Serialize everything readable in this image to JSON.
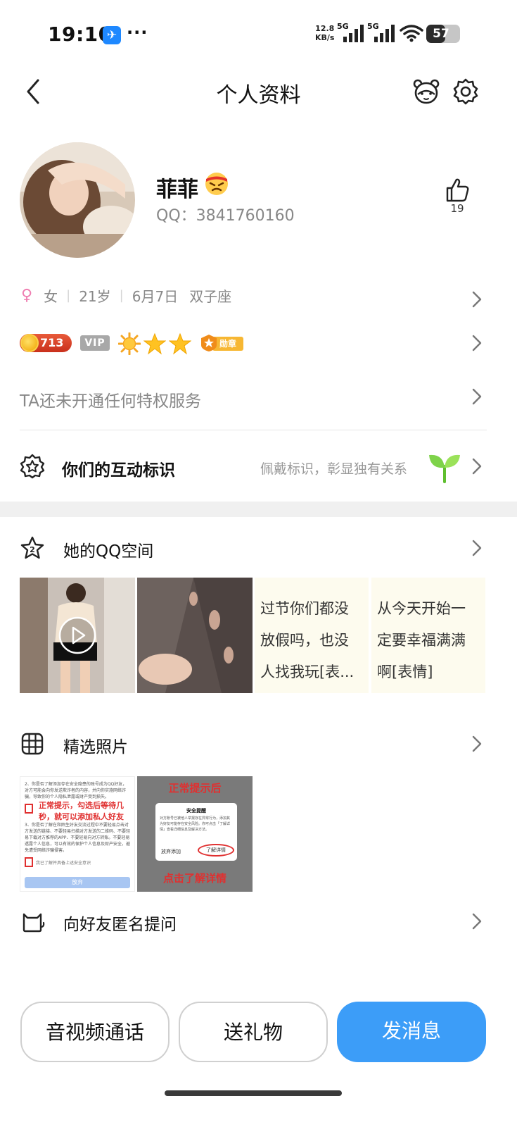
{
  "status_bar": {
    "time": "19:10",
    "app_icon_glyph": "✈",
    "more": "···",
    "net_speed_value": "12.8",
    "net_speed_unit": "KB/s",
    "signal1_label": "5G",
    "signal2_label": "5G",
    "battery": "57",
    "battery_level": 0.57
  },
  "header": {
    "title": "个人资料"
  },
  "profile": {
    "nickname": "菲菲",
    "qq_line": "QQ：3841760160",
    "like_count": "19"
  },
  "info": {
    "gender_symbol": "♀",
    "gender": "女",
    "age": "21岁",
    "birthday": "6月7日",
    "zodiac": "双子座"
  },
  "badges": {
    "coin_value": "713",
    "vip_label": "VIP",
    "medal_label": "勋章"
  },
  "privilege_text": "TA还未开通任何特权服务",
  "interaction": {
    "label": "你们的互动标识",
    "hint": "佩戴标识，彰显独有关系"
  },
  "qzone": {
    "label": "她的QQ空间",
    "notes": [
      {
        "lines": [
          "过节你们都没",
          "放假吗，也没",
          "人找我玩[表..."
        ]
      },
      {
        "lines": [
          "从今天开始一",
          "定要幸福满满",
          "啊[表情]"
        ]
      }
    ]
  },
  "photos_section": {
    "label": "精选照片",
    "photo1": {
      "text_top": "2、你是否了解添加存在安全隐患的账号成为QQ好友，对方可能会向你发送欺诈者的内容，并向你实施网络诈骗，导致你的个人隐私泄露或财产受到损失。",
      "overlay_1": "正常提示，勾选后等待几",
      "overlay_2": "秒，就可以添加私人好友",
      "text_mid": "3、你是否了解在和陌生好友交流过程中不要轻易点击对方发送的链接、不要轻易扫描对方发送的二维码、不要轻易下载对方推荐的APP、不要轻易向对方转账。不要轻易透露个人信息，可以有效的保护个人信息及财产安全，避免遭受网络诈骗侵害。",
      "check_label": "我已了解并具备上述安全意识",
      "button": "放弃"
    },
    "photo2": {
      "overlay_top": "正常提示后",
      "dialog_title": "安全提醒",
      "dialog_body": "对方账号已被他人举报存在异常行为，添加其为好友可能存在安全风险。你可点击「了解详情」查看详细信息及解决方法。",
      "btn_cancel": "放弃添加",
      "btn_detail": "了解详情",
      "overlay_bottom": "点击了解详情"
    }
  },
  "anon_question": {
    "label": "向好友匿名提问"
  },
  "buttons": {
    "call": "音视频通话",
    "gift": "送礼物",
    "message": "发消息"
  },
  "colors": {
    "primary": "#3c9df8",
    "gender": "#ef7eb1",
    "annotation_red": "#e03030"
  }
}
